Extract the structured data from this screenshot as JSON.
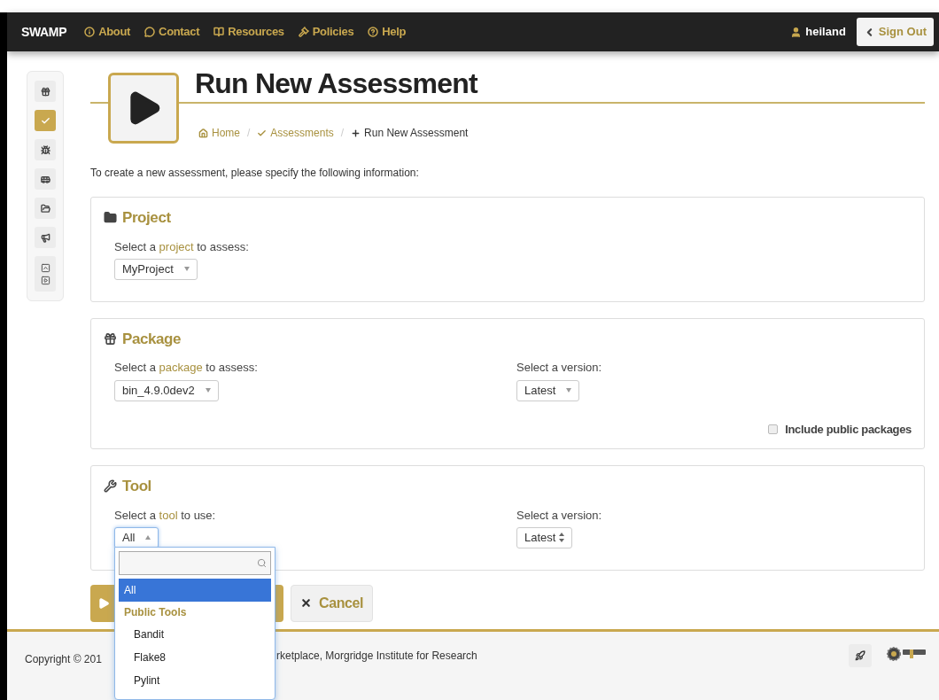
{
  "navbar": {
    "brand": "SWAMP",
    "links": [
      {
        "kind": "info",
        "label": "About"
      },
      {
        "kind": "chat",
        "label": "Contact"
      },
      {
        "kind": "book",
        "label": "Resources"
      },
      {
        "kind": "gavel",
        "label": "Policies"
      },
      {
        "kind": "help",
        "label": "Help"
      }
    ],
    "user": "heiland",
    "sign_out": "Sign Out"
  },
  "sidebar": {
    "items": [
      {
        "kind": "gift",
        "selected": false
      },
      {
        "kind": "check",
        "selected": true
      },
      {
        "kind": "bug",
        "selected": false
      },
      {
        "kind": "bus",
        "selected": false
      },
      {
        "kind": "folder",
        "selected": false
      },
      {
        "kind": "megaphone",
        "selected": false
      },
      {
        "kind": "boxes",
        "selected": false
      }
    ]
  },
  "page": {
    "title": "Run New Assessment",
    "breadcrumb": [
      {
        "kind": "home",
        "label": "Home",
        "link": true
      },
      {
        "kind": "separator",
        "label": "/"
      },
      {
        "kind": "check",
        "label": "Assessments",
        "link": true
      },
      {
        "kind": "separator",
        "label": "/"
      },
      {
        "kind": "plus",
        "label": "Run New Assessment",
        "link": false
      }
    ],
    "intro": "To create a new assessment, please specify the following information:"
  },
  "panels": [
    {
      "kind": "folder",
      "title": "Project",
      "label_prefix": "Select a ",
      "label_link": "project",
      "label_suffix": " to assess:",
      "value": "MyProject",
      "expanded": false
    },
    {
      "kind": "gift",
      "title": "Package",
      "label_prefix": "Select a ",
      "label_link": "package",
      "label_suffix": " to assess:",
      "value": "bin_4.9.0dev2",
      "expanded": false,
      "version_label": "Select a version:",
      "version_value": "Latest",
      "version_spinner": false,
      "checkbox": {
        "label": "Include public packages",
        "checked": false
      }
    },
    {
      "kind": "wrench",
      "title": "Tool",
      "label_prefix": "Select a ",
      "label_link": "tool",
      "label_suffix": " to use:",
      "value": "All",
      "expanded": true,
      "version_label": "Select a version:",
      "version_value": "Latest",
      "version_spinner": true
    }
  ],
  "dropdown": {
    "options": [
      {
        "kind": "option",
        "label": "All",
        "selected": true
      },
      {
        "kind": "group",
        "label": "Public Tools"
      },
      {
        "kind": "option",
        "label": "Bandit",
        "selected": false
      },
      {
        "kind": "option",
        "label": "Flake8",
        "selected": false
      },
      {
        "kind": "option",
        "label": "Pylint",
        "selected": false
      }
    ]
  },
  "buttons": {
    "cancel": "Cancel"
  },
  "footer": {
    "copyright_start": "Copyright © 201",
    "copyright_end": "rketplace, Morgridge Institute for Research"
  }
}
